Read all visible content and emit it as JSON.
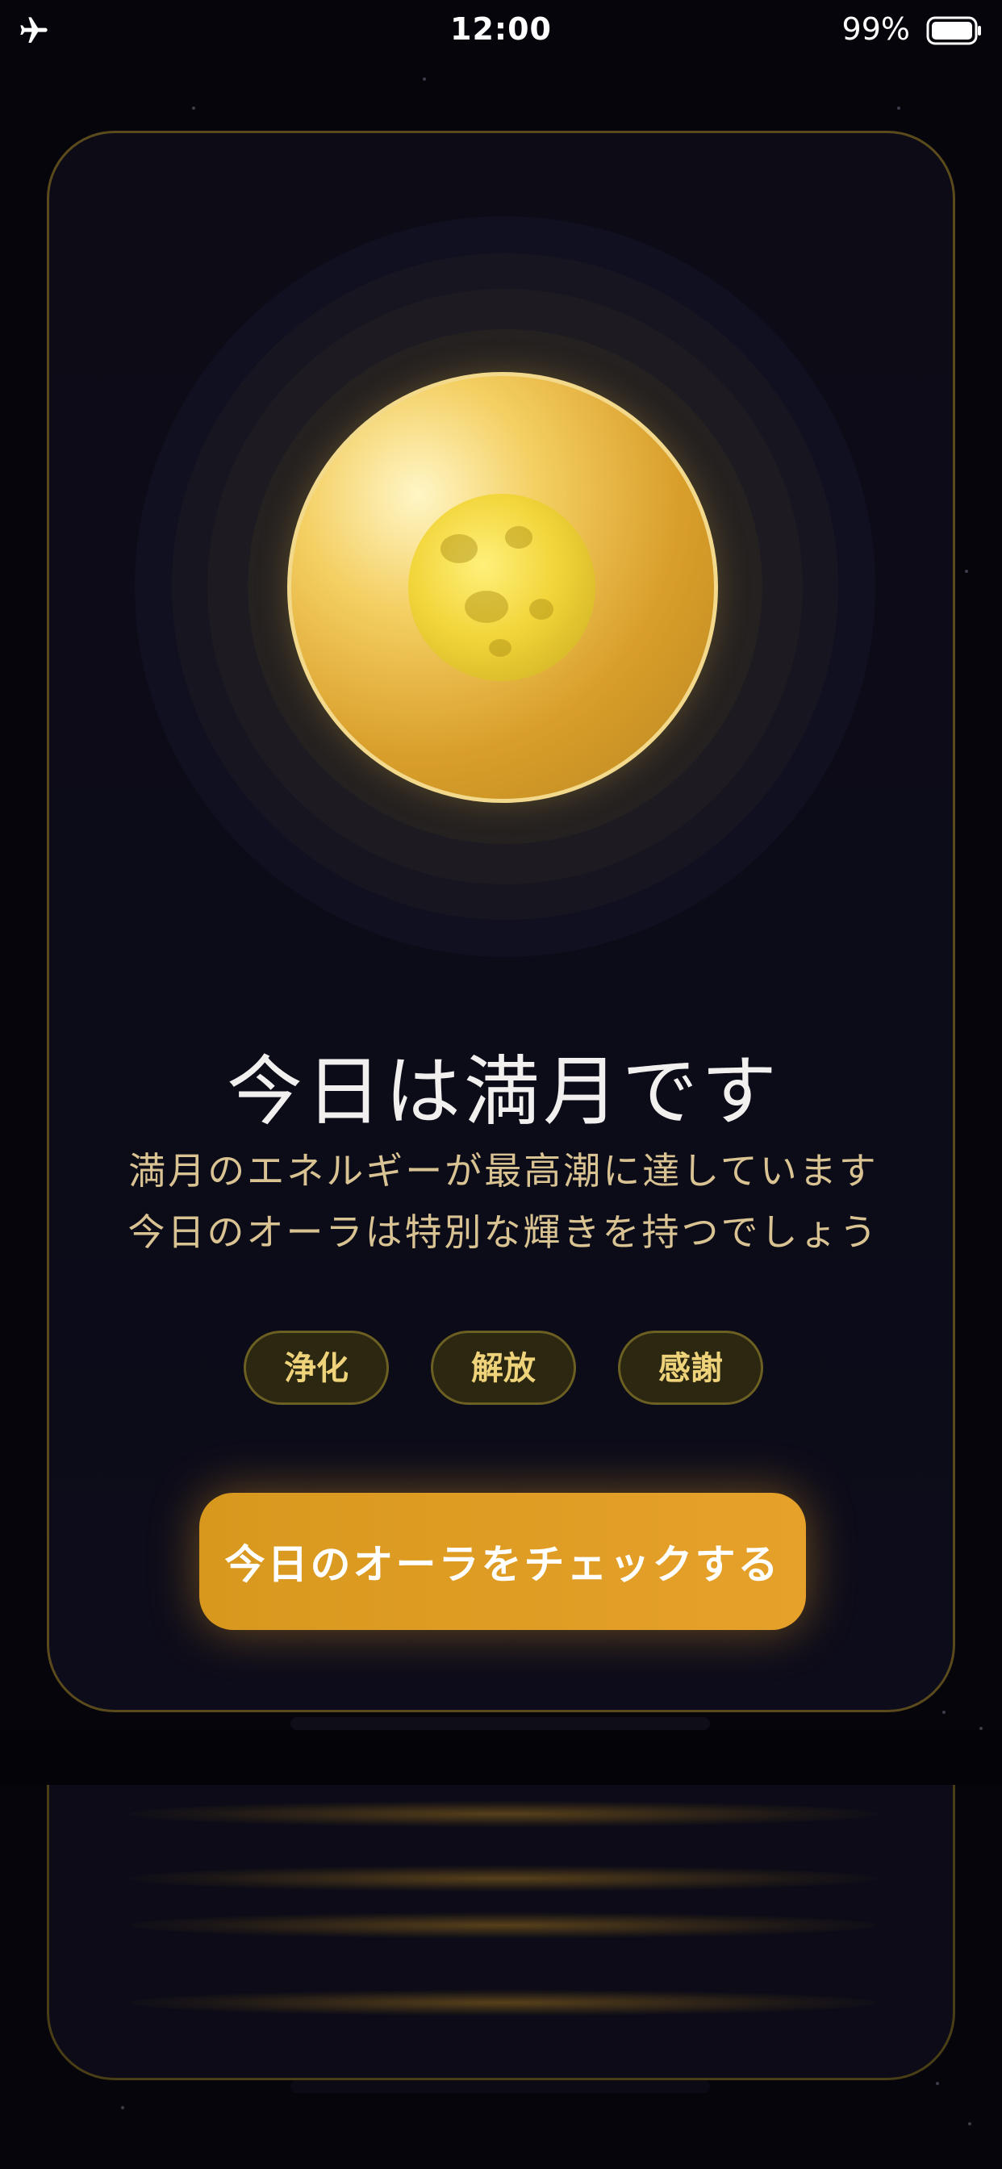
{
  "status_bar": {
    "time": "12:00",
    "battery_percent": "99%",
    "airplane_mode": true
  },
  "card": {
    "title": "今日は満月です",
    "description_line1": "満月のエネルギーが最高潮に達しています",
    "description_line2": "今日のオーラは特別な輝きを持つでしょう",
    "tags": [
      "浄化",
      "解放",
      "感謝"
    ],
    "cta_label": "今日のオーラをチェックする"
  },
  "icons": {
    "moon": "full-moon-icon",
    "airplane": "airplane-icon",
    "battery": "battery-icon"
  },
  "colors": {
    "accent": "#e0a024",
    "text_gold": "#d9c393",
    "tag_text": "#efd37a",
    "background": "#05050b"
  }
}
